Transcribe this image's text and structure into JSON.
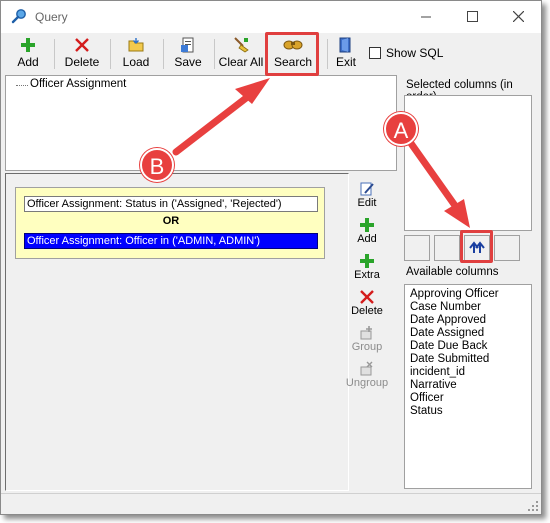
{
  "window": {
    "title": "Query",
    "icon": "query-magnifier-icon",
    "controls": [
      "minimize",
      "maximize",
      "close"
    ]
  },
  "toolbar": {
    "buttons": [
      {
        "label": "Add",
        "icon": "green-plus-icon"
      },
      {
        "label": "Delete",
        "icon": "red-x-icon"
      },
      {
        "label": "Load",
        "icon": "load-folder-icon"
      },
      {
        "label": "Save",
        "icon": "save-document-icon"
      },
      {
        "label": "Clear All",
        "icon": "broom-icon"
      },
      {
        "label": "Search",
        "icon": "search-binoculars-icon"
      },
      {
        "label": "Exit",
        "icon": "exit-door-icon"
      }
    ],
    "show_sql_label": "Show SQL",
    "show_sql_checked": false
  },
  "tree": {
    "root": "Officer Assignment"
  },
  "conditions": {
    "items": [
      "Officer Assignment: Status in ('Assigned', 'Rejected')",
      "Officer Assignment: Officer in ('ADMIN, ADMIN')"
    ],
    "operator": "OR",
    "selected_index": 1
  },
  "condition_actions": [
    {
      "label": "Edit",
      "icon": "edit-pencil-icon",
      "enabled": true
    },
    {
      "label": "Add",
      "icon": "green-plus-icon",
      "enabled": true
    },
    {
      "label": "Extra",
      "icon": "green-plus-icon",
      "enabled": true
    },
    {
      "label": "Delete",
      "icon": "red-x-icon",
      "enabled": true
    },
    {
      "label": "Group",
      "icon": "group-icon",
      "enabled": false
    },
    {
      "label": "Ungroup",
      "icon": "ungroup-icon",
      "enabled": false
    }
  ],
  "columns": {
    "selected_label": "Selected columns (in order)",
    "available_label": "Available columns",
    "available": [
      "Approving Officer",
      "Case Number",
      "Date Approved",
      "Date Assigned",
      "Date Due Back",
      "Date Submitted",
      "incident_id",
      "Narrative",
      "Officer",
      "Status"
    ],
    "move_up_icon": "move-up-arrows-icon"
  },
  "annotations": {
    "A": "A",
    "B": "B"
  },
  "colors": {
    "accent_red": "#e8403f",
    "selection_blue": "#0000ff",
    "conditions_bg": "#ffffc0"
  }
}
